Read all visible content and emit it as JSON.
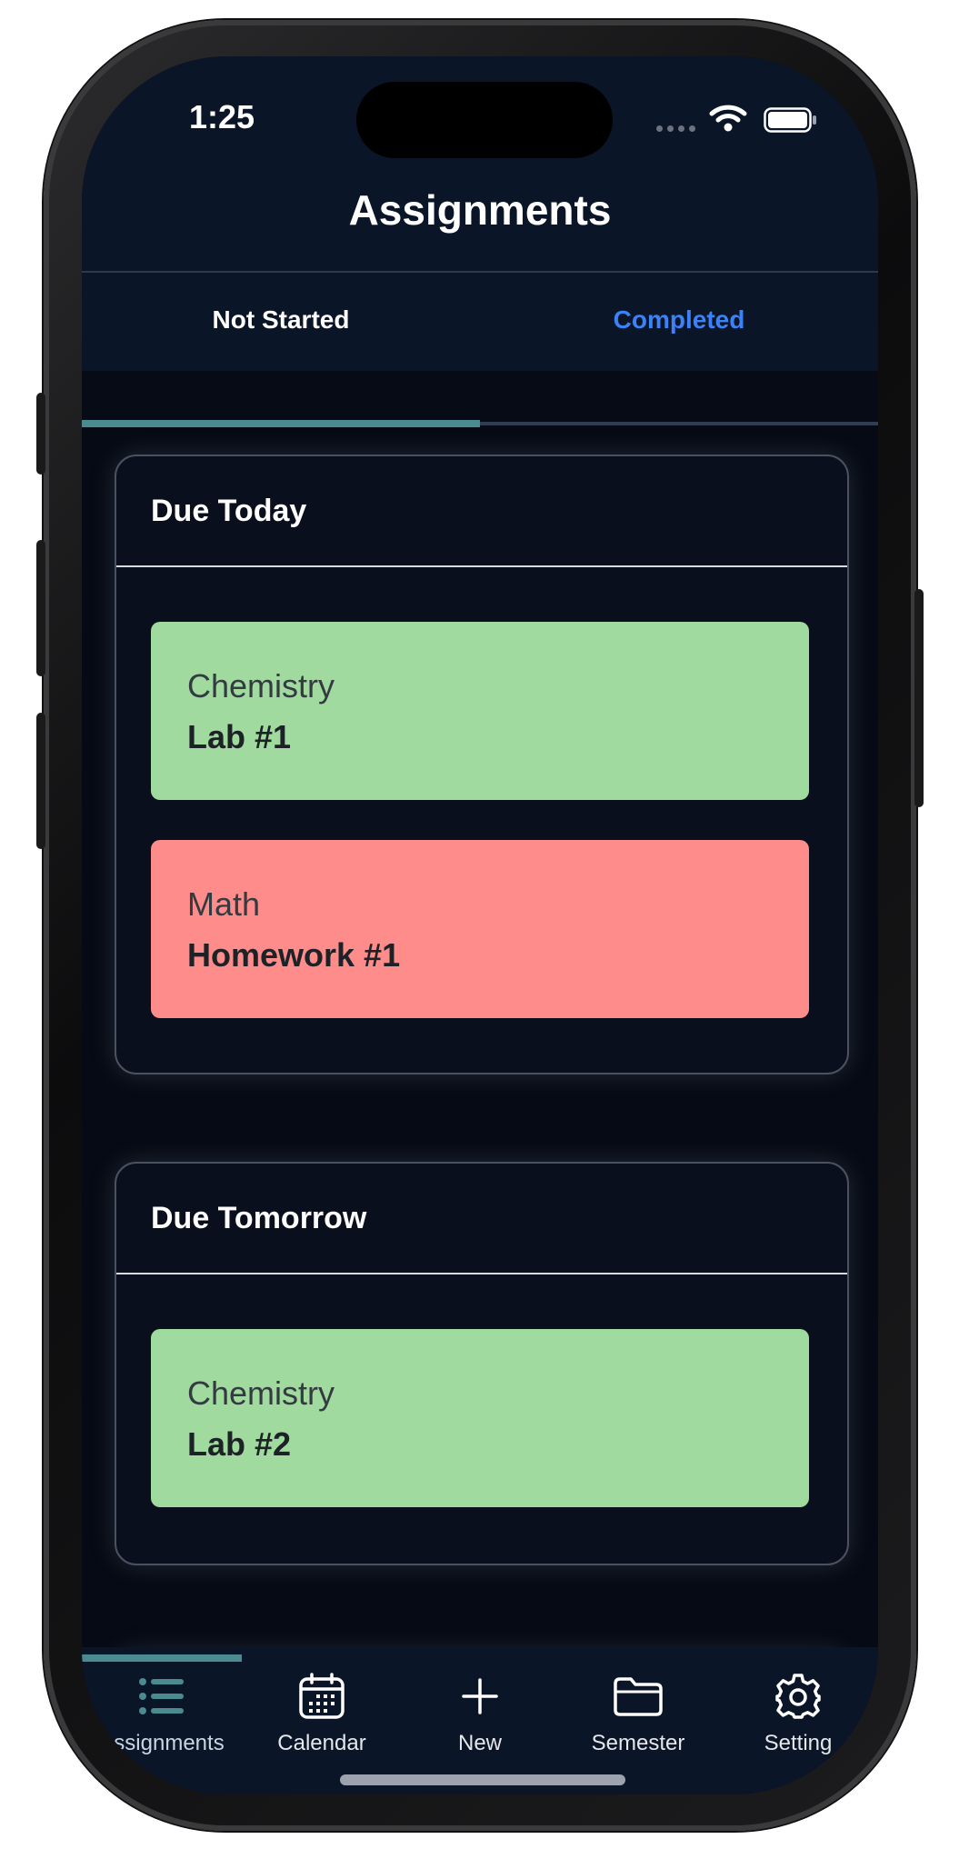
{
  "status_bar": {
    "time": "1:25"
  },
  "header": {
    "title": "Assignments"
  },
  "tabs": [
    {
      "label": "Not Started",
      "active": true
    },
    {
      "label": "Completed",
      "active": false
    }
  ],
  "sections": [
    {
      "title": "Due Today",
      "cards": [
        {
          "subject": "Chemistry",
          "name": "Lab #1",
          "color": "#a0da9e"
        },
        {
          "subject": "Math",
          "name": "Homework #1",
          "color": "#fd8c8a"
        }
      ]
    },
    {
      "title": "Due Tomorrow",
      "cards": [
        {
          "subject": "Chemistry",
          "name": "Lab #2",
          "color": "#a0da9e"
        }
      ]
    }
  ],
  "bottom_nav": [
    {
      "label": "Assignments",
      "icon": "list-icon",
      "active": true
    },
    {
      "label": "Calendar",
      "icon": "calendar-icon",
      "active": false
    },
    {
      "label": "New",
      "icon": "plus-icon",
      "active": false
    },
    {
      "label": "Semester",
      "icon": "folder-icon",
      "active": false
    },
    {
      "label": "Setting",
      "icon": "gear-icon",
      "active": false
    }
  ],
  "colors": {
    "header_bg": "#0b1528",
    "content_bg": "#050a14",
    "accent_teal": "#4b8a90",
    "tab_inactive_blue": "#3b82f6",
    "card_green": "#a0da9e",
    "card_red": "#fd8c8a"
  }
}
